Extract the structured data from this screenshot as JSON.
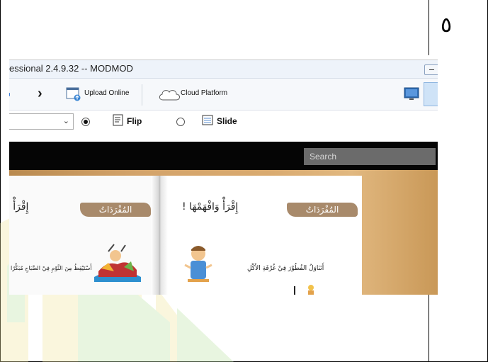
{
  "document": {
    "page_number": "٥"
  },
  "app": {
    "title": "essional 2.4.9.32 -- MODMOD",
    "toolbar": {
      "upload_label": "Upload Online",
      "cloud_label": "Cloud Platform"
    },
    "options": {
      "flip_label": "Flip",
      "slide_label": "Slide",
      "selected_mode": "Flip"
    },
    "search": {
      "placeholder": "Search"
    }
  },
  "book": {
    "left_page": {
      "banner": "المُفْرَدَاتُ",
      "heading": "إِقْرَأْ وَ",
      "caption": "أَسْتَيْقِظُ مِنَ النَّوْمِ فِيْ الصَّبَاحِ مُبَكِّرًا"
    },
    "right_page": {
      "banner": "المُفْرَدَاتُ",
      "heading": "إِقْرَأْ وَافْهَمْهَا !",
      "caption": "أَتَنَاوَلُ الفُطُوْرَ فِيْ غُرْفَةِ الأَكْلِ"
    }
  },
  "colors": {
    "banner": "#a88a6b",
    "search_bar": "#050505",
    "viewer_bg": "#d3a36a"
  }
}
